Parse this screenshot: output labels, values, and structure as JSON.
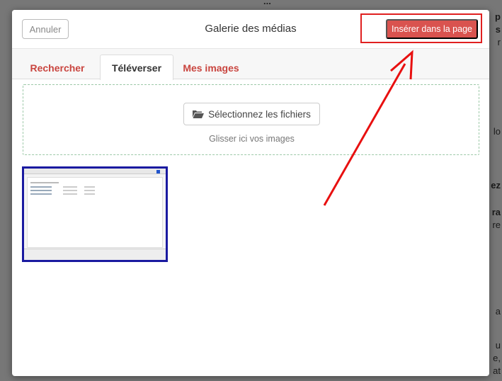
{
  "header": {
    "cancel_label": "Annuler",
    "title": "Galerie des médias",
    "insert_label": "Insérer dans la page"
  },
  "tabs": [
    {
      "label": "Rechercher",
      "active": false
    },
    {
      "label": "Téléverser",
      "active": true
    },
    {
      "label": "Mes images",
      "active": false
    }
  ],
  "dropzone": {
    "select_label": "Sélectionnez les fichiers",
    "select_icon": "folder-open-icon",
    "hint": "Glisser ici vos images"
  },
  "uploaded": {
    "count": 1
  },
  "annotation": {
    "highlight_color": "#e02020",
    "thumbnail_border_color": "#1a1aa0"
  },
  "colors": {
    "accent": "#d9534f",
    "tab_link": "#c9453f"
  }
}
